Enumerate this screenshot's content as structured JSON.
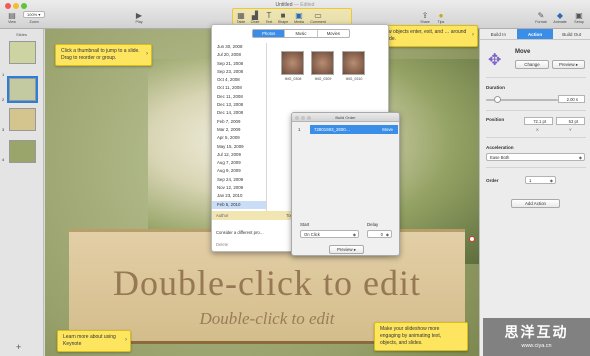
{
  "window": {
    "title": "Untitled",
    "status": "— Edited"
  },
  "toolbar": {
    "zoom_value": "100%",
    "items": [
      {
        "label": "View",
        "icon": "view-icon"
      },
      {
        "label": "Zoom",
        "icon": "zoom-icon"
      },
      {
        "label": "Play",
        "icon": "play-icon"
      },
      {
        "label": "Table",
        "icon": "table-icon"
      },
      {
        "label": "Chart",
        "icon": "chart-icon"
      },
      {
        "label": "Text",
        "icon": "text-icon"
      },
      {
        "label": "Shape",
        "icon": "shape-icon"
      },
      {
        "label": "Media",
        "icon": "media-icon"
      },
      {
        "label": "Comment",
        "icon": "comment-icon"
      },
      {
        "label": "Share",
        "icon": "share-icon"
      },
      {
        "label": "Tips",
        "icon": "tips-icon"
      },
      {
        "label": "Format",
        "icon": "format-icon"
      },
      {
        "label": "Animate",
        "icon": "animate-icon"
      },
      {
        "label": "Setup",
        "icon": "setup-icon"
      }
    ]
  },
  "navigator": {
    "title": "Slides",
    "slide_numbers": [
      "1",
      "2",
      "3",
      "4"
    ],
    "add_label": "+"
  },
  "tips": {
    "thumbnail": "Click a thumbnail to jump to a slide. Drag to reorder or group.",
    "build": "… how objects enter, exit, and … around the slide.",
    "learn": "Learn more about using Keynote",
    "engage": "Make your slideshow more engaging by animating text, objects, and slides."
  },
  "slide": {
    "title": "Double-click to edit",
    "subtitle": "Double-click to edit"
  },
  "media_browser": {
    "tabs": [
      "Photos",
      "Music",
      "Movies"
    ],
    "selected_tab": "Photos",
    "dates": [
      "Jun 30, 2008",
      "Jul 20, 2008",
      "Sep 21, 2008",
      "Sep 23, 2008",
      "Oct 4, 2008",
      "Oct 11, 2008",
      "Dec 11, 2008",
      "Dec 13, 2008",
      "Dec 14, 2008",
      "Feb 7, 2009",
      "Mar 2, 2009",
      "Apr 5, 2009",
      "May 15, 2009",
      "Jul 12, 2009",
      "Aug 7, 2009",
      "Aug 9, 2009",
      "Sep 24, 2009",
      "Nov 12, 2009",
      "Jan 23, 2010",
      "Feb 5, 2010"
    ],
    "selected_date": "Feb 5, 2010",
    "photos": [
      "IMG_0308",
      "IMG_0309",
      "IMG_0310"
    ],
    "author_label": "Author",
    "author_value": "Today 11",
    "consider": "Consider a different pro…",
    "delete": "Delete"
  },
  "build_order": {
    "title": "Build Order",
    "row_number": "1",
    "row_name": "72801593_2800…",
    "row_effect": "Move",
    "start_label": "Start",
    "start_value": "On Click",
    "delay_label": "Delay",
    "delay_value": "0",
    "preview_label": "Preview"
  },
  "inspector": {
    "tabs": [
      "Build In",
      "Action",
      "Build Out"
    ],
    "selected_tab": "Action",
    "effect": "Move",
    "change_label": "Change",
    "preview_label": "Preview",
    "duration_label": "Duration",
    "duration_value": "2.00 s",
    "position_label": "Position",
    "x_value": "72.1 pt",
    "y_value": "53 pt",
    "x_label": "X",
    "y_label": "Y",
    "acceleration_label": "Acceleration",
    "acceleration_value": "Ease Both",
    "order_label": "Order",
    "order_value": "1",
    "add_action_label": "Add Action"
  },
  "watermark": {
    "chinese": "思洋互动",
    "url": "www.ciya.cn"
  },
  "colors": {
    "accent": "#3b8ee8",
    "tip": "#fde560",
    "close": "#f25b54"
  }
}
